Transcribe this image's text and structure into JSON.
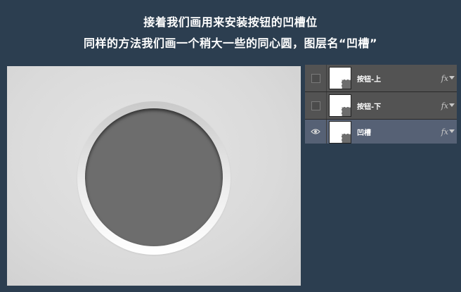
{
  "caption": {
    "line1": "接着我们画用来安装按钮的凹槽位",
    "line2": "同样的方法我们画一个稍大一些的同心圆，图层名“凹槽”"
  },
  "layers_panel": {
    "layers": [
      {
        "name": "按钮-上",
        "visible": false,
        "fx": "fx"
      },
      {
        "name": "按钮-下",
        "visible": false,
        "fx": "fx"
      },
      {
        "name": "凹槽",
        "visible": true,
        "selected": true,
        "fx": "fx"
      }
    ],
    "icons": {
      "visibility_on": "eye-icon",
      "visibility_off": "empty-box-icon",
      "effects_arrow": "chevron-down-icon"
    }
  },
  "colors": {
    "background": "#2c3e50",
    "canvas": "#dadada",
    "groove": "#6d6d6d",
    "layer_row": "#535353",
    "layer_selected": "#566175"
  }
}
